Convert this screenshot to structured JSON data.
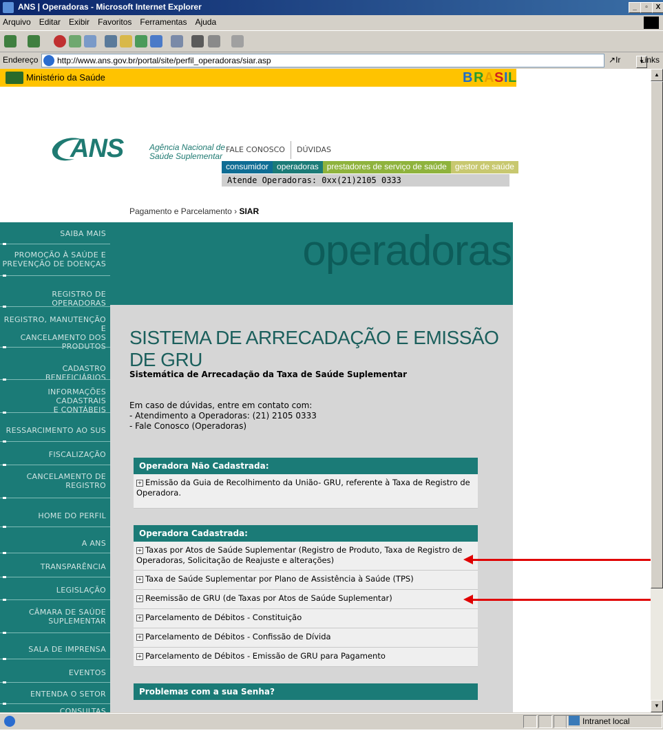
{
  "window": {
    "title": "ANS | Operadoras - Microsoft Internet Explorer",
    "min": "_",
    "max": "▫",
    "close": "X"
  },
  "menu": [
    "Arquivo",
    "Editar",
    "Exibir",
    "Favoritos",
    "Ferramentas",
    "Ajuda"
  ],
  "address": {
    "label": "Endereço",
    "url": "http://www.ans.gov.br/portal/site/perfil_operadoras/siar.asp",
    "go": "Ir",
    "links": "Links"
  },
  "ministry": {
    "label": "Ministério da Saúde",
    "brasil": "BRASIL"
  },
  "logo": {
    "ans": "ANS",
    "line1": "Agência Nacional de",
    "line2": "Saúde Suplementar"
  },
  "toplinks": [
    "FALE CONOSCO",
    "DÚVIDAS"
  ],
  "tabs": [
    {
      "label": "consumidor",
      "color": "#0f6d94"
    },
    {
      "label": "operadoras",
      "color": "#1b7b77"
    },
    {
      "label": "prestadores de serviço de saúde",
      "color": "#8fb33d"
    },
    {
      "label": "gestor de saúde",
      "color": "#c8c870"
    }
  ],
  "atende": "Atende Operadoras: 0xx(21)2105 0333",
  "breadcrumb": {
    "parent": "Pagamento e Parcelamento",
    "sep": "›",
    "current": "SIAR"
  },
  "banner": "operadoras",
  "nav": [
    [
      "SAIBA MAIS"
    ],
    [
      "PROMOÇÃO À SAÚDE E",
      "PREVENÇÃO DE DOENÇAS"
    ],
    [
      "REGISTRO DE OPERADORAS"
    ],
    [
      "REGISTRO, MANUTENÇÃO E",
      "CANCELAMENTO DOS",
      "PRODUTOS"
    ],
    [
      "CADASTRO BENEFICIÁRIOS"
    ],
    [
      "INFORMAÇÕES CADASTRAIS",
      "E CONTÁBEIS"
    ],
    [
      "RESSARCIMENTO AO SUS"
    ],
    [
      "FISCALIZAÇÃO"
    ],
    [
      "CANCELAMENTO DE",
      "REGISTRO"
    ],
    [
      "HOME DO PERFIL"
    ],
    [
      "A ANS"
    ],
    [
      "TRANSPARÊNCIA"
    ],
    [
      "LEGISLAÇÃO"
    ],
    [
      "CÂMARA DE SAÚDE",
      "SUPLEMENTAR"
    ],
    [
      "SALA DE IMPRENSA"
    ],
    [
      "EVENTOS"
    ],
    [
      "ENTENDA O SETOR"
    ],
    [
      "CONSULTAS"
    ]
  ],
  "main": {
    "title": "SISTEMA DE ARRECADAÇÃO E EMISSÃO DE GRU",
    "subtitle": "Sistemática de Arrecadação da Taxa de Saúde Suplementar",
    "contact": [
      "Em caso de dúvidas, entre em contato com:",
      "- Atendimento a Operadoras: (21) 2105 0333",
      "- Fale Conosco (Operadoras)"
    ],
    "panel1": {
      "header": "Operadora Não Cadastrada:",
      "items": [
        "Emissão da Guia de Recolhimento da União- GRU, referente à Taxa de Registro de Operadora."
      ]
    },
    "panel2": {
      "header": "Operadora Cadastrada:",
      "items": [
        "Taxas por Atos de Saúde Suplementar (Registro de Produto, Taxa de Registro de Operadoras, Solicitação de Reajuste e alterações)",
        "Taxa de Saúde Suplementar por Plano de Assistência à Saúde (TPS)",
        "Reemissão de GRU (de Taxas por Atos de Saúde Suplementar)",
        "Parcelamento de Débitos - Constituição",
        "Parcelamento de Débitos - Confissão de Dívida",
        "Parcelamento de Débitos - Emissão de GRU para Pagamento"
      ]
    },
    "panel3": {
      "header": "Problemas com a sua Senha?"
    }
  },
  "status": {
    "zone": "Intranet local"
  },
  "colors": {
    "teal": "#1b7b77",
    "ministry_bar": "#ffc300",
    "arrow": "#e00000"
  }
}
